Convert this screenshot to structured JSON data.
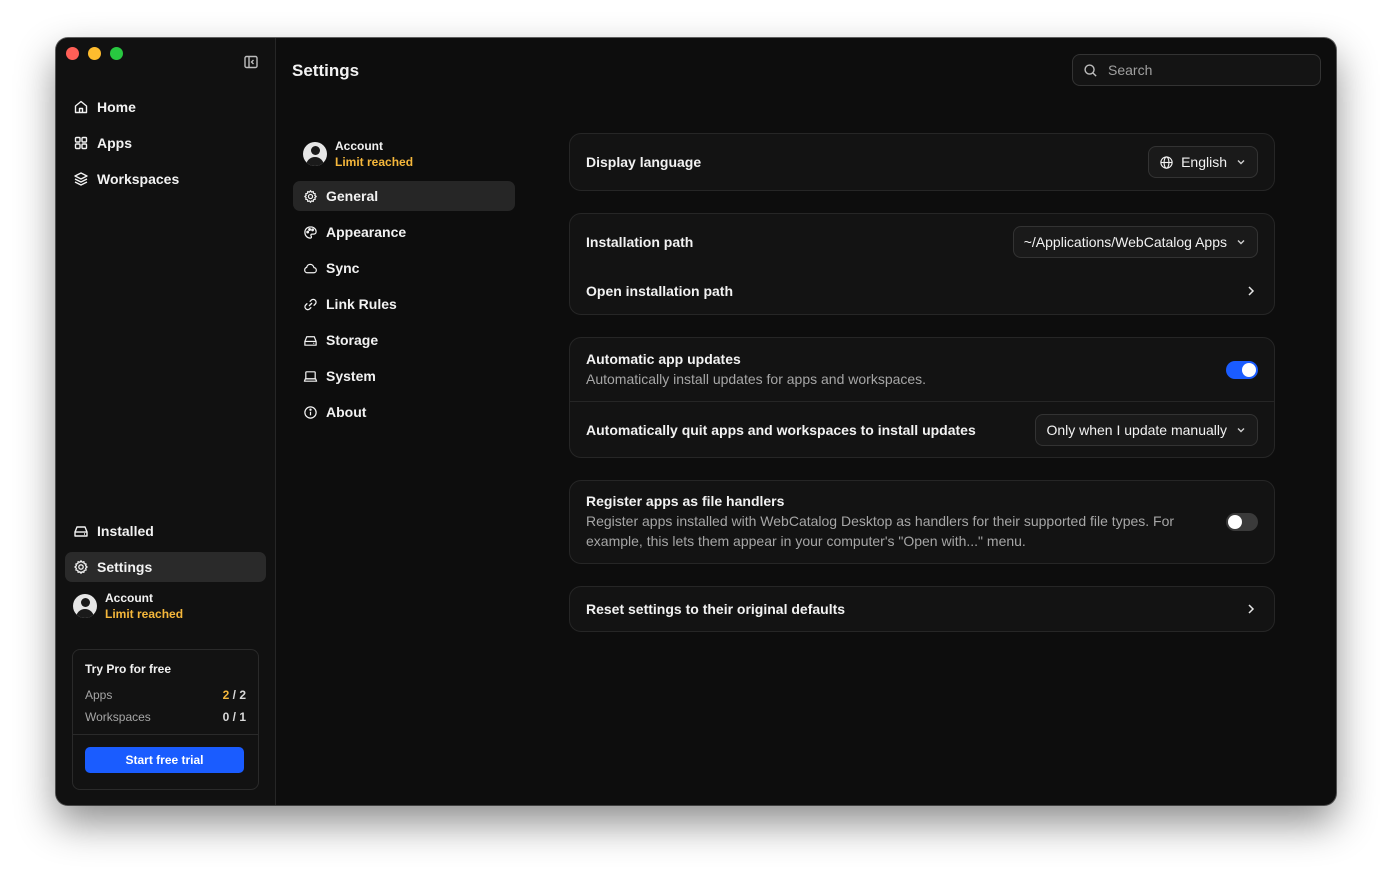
{
  "sidebar": {
    "nav": [
      {
        "label": "Home",
        "icon": "home-icon"
      },
      {
        "label": "Apps",
        "icon": "grid-icon"
      },
      {
        "label": "Workspaces",
        "icon": "layers-icon"
      }
    ],
    "bottom_nav": [
      {
        "label": "Installed",
        "icon": "drive-icon"
      },
      {
        "label": "Settings",
        "icon": "gear-icon"
      }
    ],
    "account": {
      "name": "Account",
      "status": "Limit reached"
    },
    "pro_card": {
      "title": "Try Pro for free",
      "apps_label": "Apps",
      "apps_used": "2",
      "apps_total": " / 2",
      "workspaces_label": "Workspaces",
      "workspaces_value": "0 / 1",
      "button_label": "Start free trial"
    }
  },
  "header": {
    "title": "Settings",
    "search_placeholder": "Search"
  },
  "subnav": {
    "account": {
      "name": "Account",
      "status": "Limit reached"
    },
    "items": [
      {
        "label": "General",
        "icon": "gear-icon",
        "active": true
      },
      {
        "label": "Appearance",
        "icon": "palette-icon"
      },
      {
        "label": "Sync",
        "icon": "cloud-icon"
      },
      {
        "label": "Link Rules",
        "icon": "link-icon"
      },
      {
        "label": "Storage",
        "icon": "drive-icon"
      },
      {
        "label": "System",
        "icon": "laptop-icon"
      },
      {
        "label": "About",
        "icon": "info-icon"
      }
    ]
  },
  "settings": {
    "display_language": {
      "label": "Display language",
      "value": "English"
    },
    "installation_path": {
      "label": "Installation path",
      "value": "~/Applications/WebCatalog Apps"
    },
    "open_installation_path": {
      "label": "Open installation path"
    },
    "auto_updates": {
      "label": "Automatic app updates",
      "description": "Automatically install updates for apps and workspaces.",
      "enabled": true
    },
    "auto_quit": {
      "label": "Automatically quit apps and workspaces to install updates",
      "value": "Only when I update manually"
    },
    "file_handlers": {
      "label": "Register apps as file handlers",
      "description": "Register apps installed with WebCatalog Desktop as handlers for their supported file types. For example, this lets them appear in your computer's \"Open with...\" menu.",
      "enabled": false
    },
    "reset": {
      "label": "Reset settings to their original defaults"
    }
  },
  "colors": {
    "accent": "#1a5cff",
    "warning": "#f5b73b",
    "background": "#0d0d0d"
  }
}
